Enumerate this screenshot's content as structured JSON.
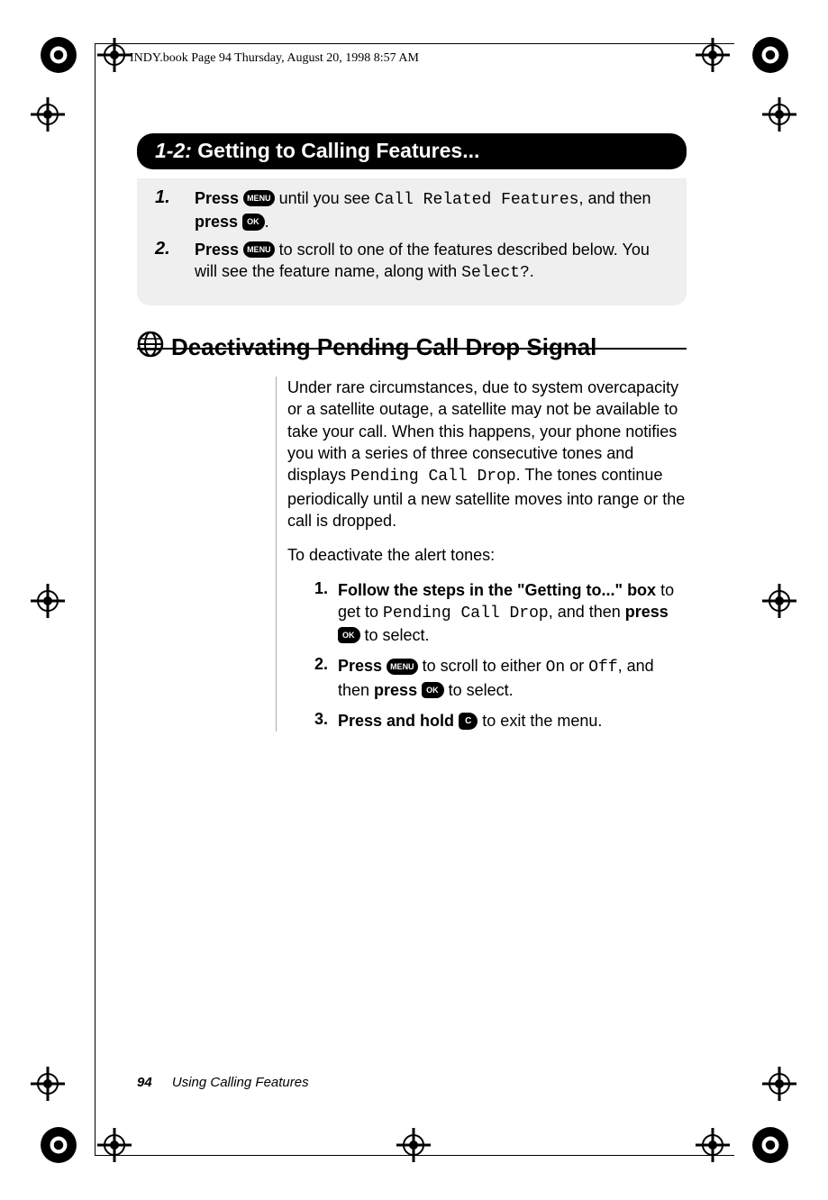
{
  "header": {
    "running": "INDY.book  Page 94  Thursday, August 20, 1998  8:57 AM"
  },
  "pill": {
    "num": "1-2:",
    "title": "Getting to Calling Features..."
  },
  "box_steps": [
    {
      "num": "1.",
      "press1": "Press",
      "key1": "MENU",
      "mid1": " until you see ",
      "lcd1": "Call Related Features",
      "mid2": ", and then ",
      "press2": "press",
      "key2": "OK",
      "end": "."
    },
    {
      "num": "2.",
      "press1": "Press",
      "key1": "MENU",
      "mid1": " to scroll to one of the features described below. You will see the feature name, along with ",
      "lcd1": "Select?",
      "end": "."
    }
  ],
  "section": {
    "title": "Deactivating Pending Call Drop Signal"
  },
  "body": {
    "p1a": "Under rare circumstances, due to system overcapacity or a satellite outage, a satellite may not be available to take your call. When this happens, your phone notifies you with a series of three consecutive tones and displays ",
    "p1_lcd": "Pending Call Drop",
    "p1b": ". The tones continue periodically until a new satellite moves into range or the call is dropped.",
    "p2": "To deactivate the alert tones:"
  },
  "steps": [
    {
      "n": "1.",
      "bold1": "Follow the steps in the \"Getting to...\" box",
      "mid1": " to get to ",
      "lcd1": "Pending Call Drop",
      "mid2": ", and then ",
      "bold2": "press",
      "key1": "OK",
      "mid3": " to select."
    },
    {
      "n": "2.",
      "bold1": "Press",
      "key0": "MENU",
      "mid1": " to scroll to either ",
      "lcd1": "On",
      "mid2": " or ",
      "lcd2": "Off",
      "mid3": ", and then ",
      "bold2": "press",
      "key1": "OK",
      "mid4": " to select."
    },
    {
      "n": "3.",
      "bold1": "Press and hold",
      "key1": "C",
      "mid1": " to exit the menu."
    }
  ],
  "footer": {
    "page": "94",
    "title": "Using Calling Features"
  }
}
